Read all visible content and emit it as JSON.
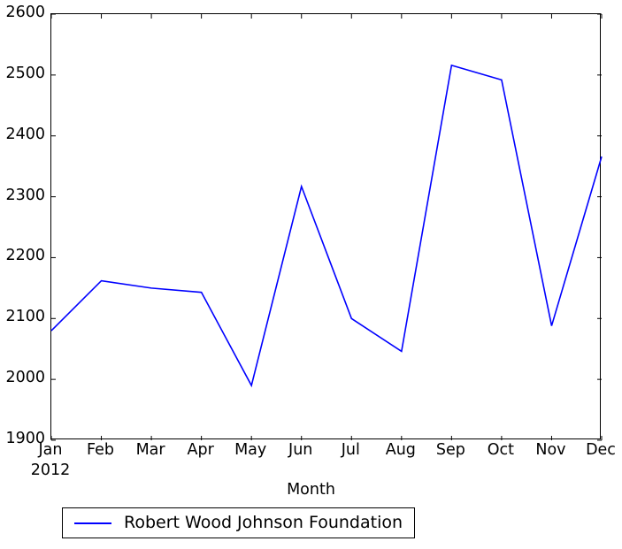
{
  "chart_data": {
    "type": "line",
    "title": "",
    "xlabel": "Month",
    "ylabel": "",
    "categories": [
      "Jan",
      "Feb",
      "Mar",
      "Apr",
      "May",
      "Jun",
      "Jul",
      "Aug",
      "Sep",
      "Oct",
      "Nov",
      "Dec"
    ],
    "x_sublabels": [
      "2012",
      "",
      "",
      "",
      "",
      "",
      "",
      "",
      "",
      "",
      "",
      ""
    ],
    "series": [
      {
        "name": "Robert Wood Johnson Foundation",
        "color": "#0000ff",
        "values": [
          2080,
          2162,
          2150,
          2143,
          1990,
          2317,
          2100,
          2046,
          2516,
          2492,
          2088,
          2366
        ]
      }
    ],
    "ylim": [
      1900,
      2600
    ],
    "yticks": [
      1900,
      2000,
      2100,
      2200,
      2300,
      2400,
      2500,
      2600
    ],
    "ytick_labels": [
      "1900",
      "2000",
      "2100",
      "2200",
      "2300",
      "2400",
      "2500",
      "2600"
    ],
    "xlim": [
      0,
      11
    ],
    "grid": false,
    "legend_position": "below-center",
    "legend_entries": [
      "Robert Wood Johnson Foundation"
    ]
  },
  "figure": {
    "background_color": "#ffffff",
    "axes_edge_color": "#000000"
  }
}
